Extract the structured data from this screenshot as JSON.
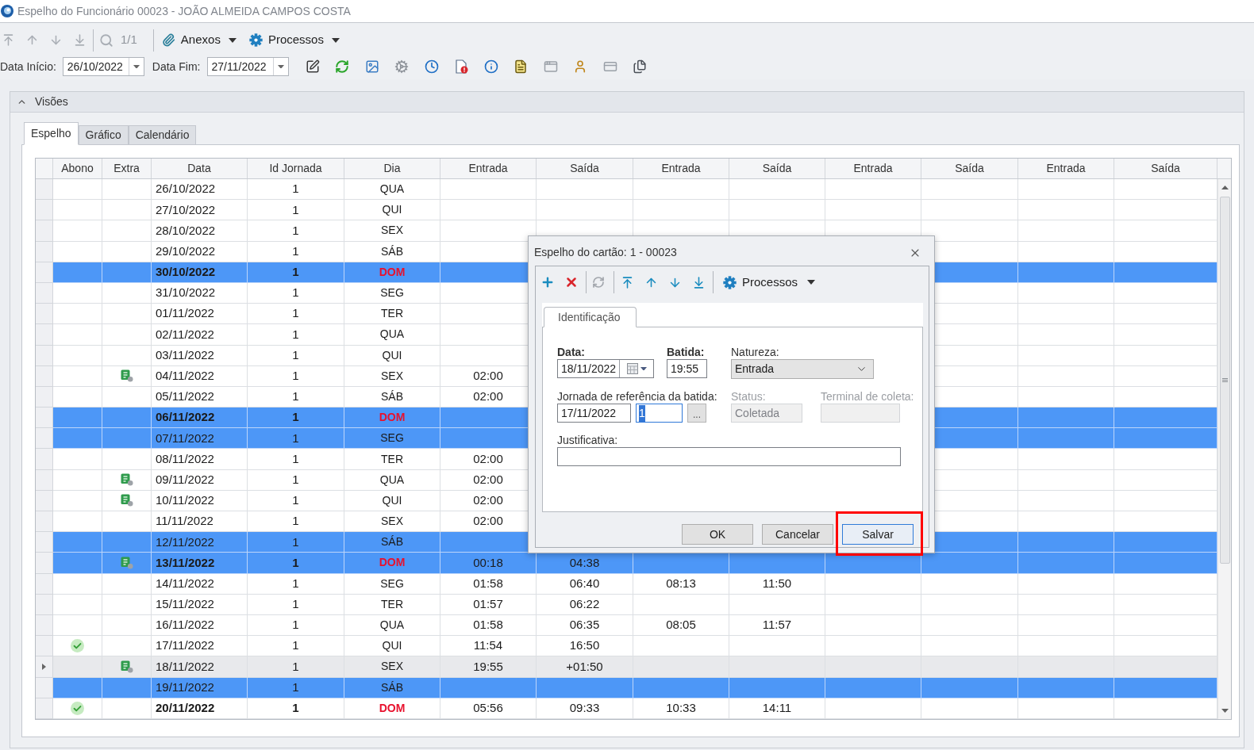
{
  "window": {
    "title": "Espelho do Funcionário 00023 - JOÃO ALMEIDA CAMPOS COSTA"
  },
  "toolbar": {
    "navigation_disabled": true,
    "page_counter": "1/1",
    "menus": [
      {
        "kind": "attachments",
        "label": "Anexos"
      },
      {
        "kind": "processes",
        "label": "Processos"
      }
    ]
  },
  "filters": [
    {
      "label": "Data Início:",
      "value": "26/10/2022"
    },
    {
      "label": "Data Fim:",
      "value": "27/11/2022"
    }
  ],
  "group": {
    "title": "Visões",
    "expanded": true
  },
  "tabs": [
    {
      "label": "Espelho",
      "selected": true
    },
    {
      "label": "Gráfico",
      "selected": false
    },
    {
      "label": "Calendário",
      "selected": false
    }
  ],
  "table": {
    "columns": [
      "Abono",
      "Extra",
      "Data",
      "Id Jornada",
      "Dia",
      "Entrada",
      "Saída",
      "Entrada",
      "Saída",
      "Entrada",
      "Saída",
      "Entrada",
      "Saída"
    ],
    "rows": [
      {
        "date": "26/10/2022",
        "journey": "1",
        "day": "QUA",
        "sunday": false,
        "highlighted": false,
        "selected": false,
        "abono": false,
        "extra": false
      },
      {
        "date": "27/10/2022",
        "journey": "1",
        "day": "QUI",
        "sunday": false,
        "highlighted": false,
        "selected": false,
        "abono": false,
        "extra": false
      },
      {
        "date": "28/10/2022",
        "journey": "1",
        "day": "SEX",
        "sunday": false,
        "highlighted": false,
        "selected": false,
        "abono": false,
        "extra": false
      },
      {
        "date": "29/10/2022",
        "journey": "1",
        "day": "SÁB",
        "sunday": false,
        "highlighted": false,
        "selected": false,
        "abono": false,
        "extra": false
      },
      {
        "date": "30/10/2022",
        "journey": "1",
        "day": "DOM",
        "sunday": true,
        "highlighted": true,
        "selected": false,
        "abono": false,
        "extra": false
      },
      {
        "date": "31/10/2022",
        "journey": "1",
        "day": "SEG",
        "sunday": false,
        "highlighted": false,
        "selected": false,
        "abono": false,
        "extra": false
      },
      {
        "date": "01/11/2022",
        "journey": "1",
        "day": "TER",
        "sunday": false,
        "highlighted": false,
        "selected": false,
        "abono": false,
        "extra": false
      },
      {
        "date": "02/11/2022",
        "journey": "1",
        "day": "QUA",
        "sunday": false,
        "highlighted": false,
        "selected": false,
        "abono": false,
        "extra": false
      },
      {
        "date": "03/11/2022",
        "journey": "1",
        "day": "QUI",
        "sunday": false,
        "highlighted": false,
        "selected": false,
        "abono": false,
        "extra": false
      },
      {
        "date": "04/11/2022",
        "journey": "1",
        "day": "SEX",
        "sunday": false,
        "highlighted": false,
        "selected": false,
        "abono": false,
        "extra": true,
        "punches": [
          "02:00"
        ]
      },
      {
        "date": "05/11/2022",
        "journey": "1",
        "day": "SÁB",
        "sunday": false,
        "highlighted": false,
        "selected": false,
        "abono": false,
        "extra": false,
        "punches": [
          "02:00"
        ]
      },
      {
        "date": "06/11/2022",
        "journey": "1",
        "day": "DOM",
        "sunday": true,
        "highlighted": true,
        "selected": false,
        "abono": false,
        "extra": false
      },
      {
        "date": "07/11/2022",
        "journey": "1",
        "day": "SEG",
        "sunday": false,
        "highlighted": true,
        "selected": false,
        "abono": false,
        "extra": false
      },
      {
        "date": "08/11/2022",
        "journey": "1",
        "day": "TER",
        "sunday": false,
        "highlighted": false,
        "selected": false,
        "abono": false,
        "extra": false,
        "punches": [
          "02:00"
        ]
      },
      {
        "date": "09/11/2022",
        "journey": "1",
        "day": "QUA",
        "sunday": false,
        "highlighted": false,
        "selected": false,
        "abono": false,
        "extra": true,
        "punches": [
          "02:00"
        ]
      },
      {
        "date": "10/11/2022",
        "journey": "1",
        "day": "QUI",
        "sunday": false,
        "highlighted": false,
        "selected": false,
        "abono": false,
        "extra": true,
        "punches": [
          "02:00"
        ]
      },
      {
        "date": "11/11/2022",
        "journey": "1",
        "day": "SEX",
        "sunday": false,
        "highlighted": false,
        "selected": false,
        "abono": false,
        "extra": false,
        "punches": [
          "02:00"
        ]
      },
      {
        "date": "12/11/2022",
        "journey": "1",
        "day": "SÁB",
        "sunday": false,
        "highlighted": true,
        "selected": false,
        "abono": false,
        "extra": false
      },
      {
        "date": "13/11/2022",
        "journey": "1",
        "day": "DOM",
        "sunday": true,
        "highlighted": true,
        "selected": false,
        "abono": false,
        "extra": true,
        "punches": [
          "00:18",
          "04:38"
        ]
      },
      {
        "date": "14/11/2022",
        "journey": "1",
        "day": "SEG",
        "sunday": false,
        "highlighted": false,
        "selected": false,
        "abono": false,
        "extra": false,
        "punches": [
          "01:58",
          "06:40",
          "08:13",
          "11:50"
        ]
      },
      {
        "date": "15/11/2022",
        "journey": "1",
        "day": "TER",
        "sunday": false,
        "highlighted": false,
        "selected": false,
        "abono": false,
        "extra": false,
        "punches": [
          "01:57",
          "06:22"
        ]
      },
      {
        "date": "16/11/2022",
        "journey": "1",
        "day": "QUA",
        "sunday": false,
        "highlighted": false,
        "selected": false,
        "abono": false,
        "extra": false,
        "punches": [
          "01:58",
          "06:35",
          "08:05",
          "11:57"
        ]
      },
      {
        "date": "17/11/2022",
        "journey": "1",
        "day": "QUI",
        "sunday": false,
        "highlighted": false,
        "selected": false,
        "abono": true,
        "extra": false,
        "punches": [
          "11:54",
          "16:50"
        ]
      },
      {
        "date": "18/11/2022",
        "journey": "1",
        "day": "SEX",
        "sunday": false,
        "highlighted": false,
        "selected": true,
        "abono": false,
        "extra": true,
        "punches": [
          "19:55",
          "+01:50"
        ]
      },
      {
        "date": "19/11/2022",
        "journey": "1",
        "day": "SÁB",
        "sunday": false,
        "highlighted": true,
        "selected": false,
        "abono": false,
        "extra": false
      },
      {
        "date": "20/11/2022",
        "journey": "1",
        "day": "DOM",
        "sunday": true,
        "highlighted": false,
        "selected": false,
        "abono": true,
        "extra": false,
        "punches": [
          "05:56",
          "09:33",
          "10:33",
          "14:11"
        ]
      }
    ]
  },
  "dialog": {
    "title": "Espelho do cartão: 1 - 00023",
    "toolbar": {
      "sync_disabled": true,
      "menu": "Processos"
    },
    "tabs": [
      {
        "label": "Identificação",
        "selected": true
      }
    ],
    "date": {
      "label": "Data:",
      "required": true,
      "value": "18/11/2022"
    },
    "punch": {
      "label": "Batida:",
      "required": true,
      "value": "19:55"
    },
    "nature": {
      "label": "Natureza:",
      "value": "Entrada"
    },
    "reference": {
      "label": "Jornada de referência da batida:",
      "date": "17/11/2022",
      "id": "1",
      "focused": true,
      "browse": "..."
    },
    "status": {
      "label": "Status:",
      "value": "Coletada",
      "disabled": true
    },
    "terminal": {
      "label": "Terminal de coleta:",
      "disabled": true
    },
    "justification": {
      "label": "Justificativa:"
    },
    "buttons": [
      {
        "label": "OK",
        "focused": false,
        "highlighted": false
      },
      {
        "label": "Cancelar",
        "focused": false,
        "highlighted": false
      },
      {
        "label": "Salvar",
        "focused": true,
        "highlighted": true
      }
    ]
  }
}
